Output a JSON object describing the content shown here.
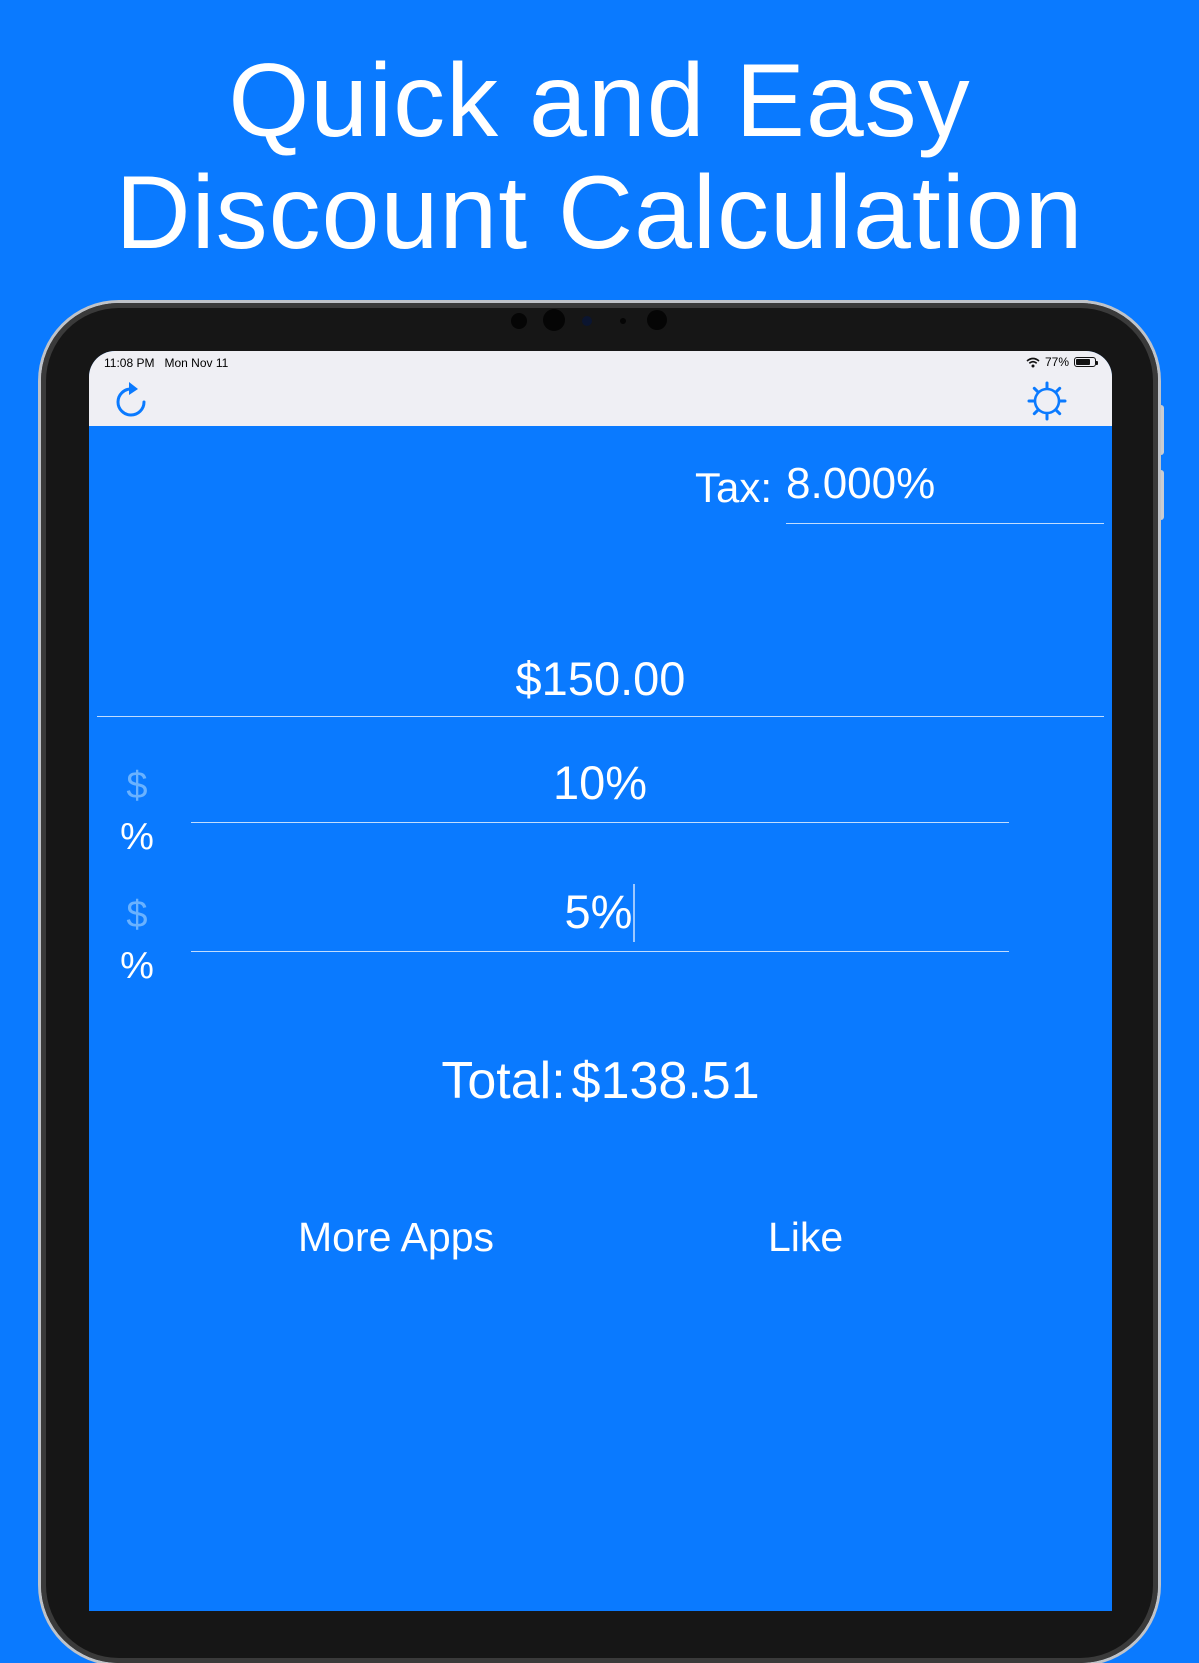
{
  "headline": {
    "line1": "Quick and Easy",
    "line2": "Discount Calculation"
  },
  "status_bar": {
    "time": "11:08 PM",
    "date": "Mon Nov 11",
    "battery": "77%"
  },
  "toolbar": {
    "refresh_icon": "refresh-icon",
    "settings_icon": "gear-icon"
  },
  "tax": {
    "label": "Tax:",
    "value": "8.000%"
  },
  "price": {
    "value": "$150.00"
  },
  "discounts": [
    {
      "dollar_symbol": "$",
      "percent_symbol": "%",
      "value": "10%"
    },
    {
      "dollar_symbol": "$",
      "percent_symbol": "%",
      "value": "5%"
    }
  ],
  "total": {
    "label": "Total:",
    "value": "$138.51"
  },
  "links": {
    "more_apps": "More Apps",
    "like": "Like"
  },
  "colors": {
    "background": "#0a7aff",
    "toolbar": "#efeff4",
    "accent": "#0a7aff",
    "inactive_symbol": "#6ab2ff"
  }
}
